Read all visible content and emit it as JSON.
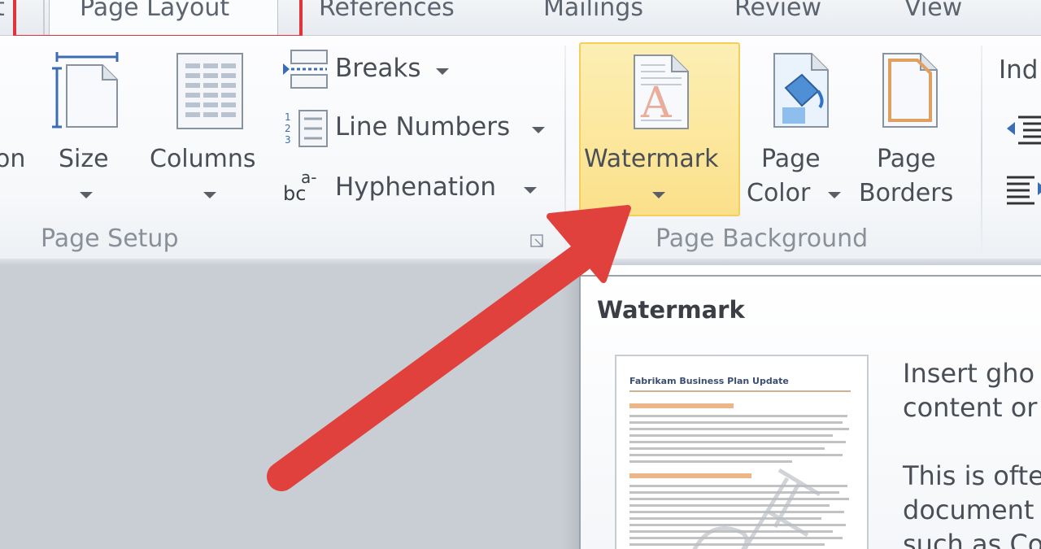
{
  "tabs": [
    {
      "label": "t"
    },
    {
      "label": "Page Layout",
      "active": true,
      "highlighted": true
    },
    {
      "label": "References"
    },
    {
      "label": "Mailings"
    },
    {
      "label": "Review"
    },
    {
      "label": "View"
    }
  ],
  "ribbon": {
    "page_setup": {
      "group_label": "Page Setup",
      "orientation_partial": "on",
      "size_label": "Size",
      "columns_label": "Columns",
      "breaks_label": "Breaks",
      "line_numbers_label": "Line Numbers",
      "hyphenation_label": "Hyphenation",
      "hyphenation_icon_text": "a-",
      "hyphenation_icon_text2": "bc"
    },
    "page_background": {
      "group_label": "Page Background",
      "watermark_label": "Watermark",
      "page_color_label_1": "Page",
      "page_color_label_2": "Color",
      "page_borders_label_1": "Page",
      "page_borders_label_2": "Borders"
    },
    "paragraph": {
      "indent_partial": "Ind"
    }
  },
  "tooltip": {
    "title": "Watermark",
    "thumb_title": "Fabrikam Business Plan Update",
    "lines": [
      "Insert gho",
      "content or",
      "",
      "This is ofte",
      "document",
      "such as Co"
    ]
  },
  "colors": {
    "highlight_red": "#e2333b",
    "watermark_hover": "#fbe08a",
    "arrow_red": "#e0413d"
  },
  "icons": {
    "size": "size-page-icon",
    "columns": "columns-icon",
    "breaks": "breaks-icon",
    "line_numbers": "line-numbers-icon",
    "hyphenation": "hyphenation-icon",
    "watermark": "watermark-icon",
    "page_color": "page-color-icon",
    "page_borders": "page-borders-icon"
  }
}
